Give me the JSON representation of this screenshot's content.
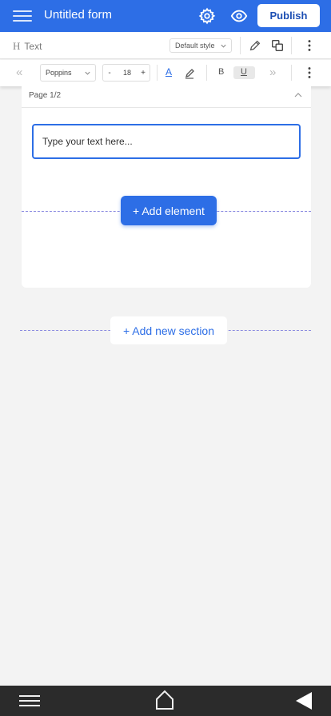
{
  "app": {
    "title": "Untitled form",
    "publish_label": "Publish",
    "accent_color": "#2d6ee6"
  },
  "toolbar1": {
    "element_type_icon": "H",
    "element_type_label": "Text",
    "style_select_value": "Default style",
    "icons": [
      "edit-pencil-icon",
      "duplicate-icon",
      "more-vertical-icon"
    ]
  },
  "toolbar2": {
    "undo_icon": "«",
    "font_value": "Poppins",
    "font_size": {
      "minus": "-",
      "value": "18",
      "plus": "+"
    },
    "text_color_label": "A",
    "bold_label": "B",
    "underline_label": "U",
    "redo_icon": "»"
  },
  "page": {
    "header_label": "Page 1/2",
    "text_input_placeholder": "Type your text here..."
  },
  "actions": {
    "add_element_label": "+ Add element",
    "add_section_label": "+ Add new section"
  },
  "system_nav": {
    "icons": [
      "menu-icon",
      "home-icon",
      "back-icon"
    ]
  }
}
